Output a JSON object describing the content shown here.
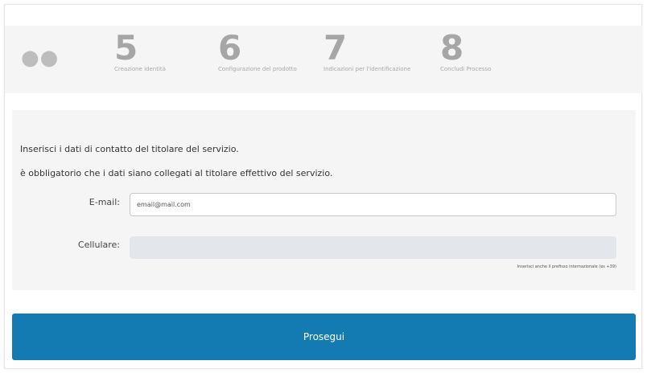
{
  "stepper": {
    "ellipsis": "●●",
    "steps": [
      {
        "number": "5",
        "label": "Creazione identità"
      },
      {
        "number": "6",
        "label": "Configurazione del prodotto"
      },
      {
        "number": "7",
        "label": "Indicazioni per l'identificazione"
      },
      {
        "number": "8",
        "label": "Concludi Processo"
      }
    ]
  },
  "form": {
    "intro_line_1": "Inserisci i dati di contatto del titolare del servizio.",
    "intro_line_2": "è obbligatorio che i dati siano collegati al titolare effettivo del servizio.",
    "email": {
      "label": "E-mail:",
      "value": "email@mail.com"
    },
    "mobile": {
      "label": "Cellulare:",
      "value": "",
      "hint": "Inserisci anche il prefisso internazionale (es +39)"
    }
  },
  "actions": {
    "continue_label": "Prosegui"
  },
  "colors": {
    "primary_button": "#137bb1",
    "panel_background": "#f5f5f5",
    "step_number": "#a6a6a6"
  }
}
